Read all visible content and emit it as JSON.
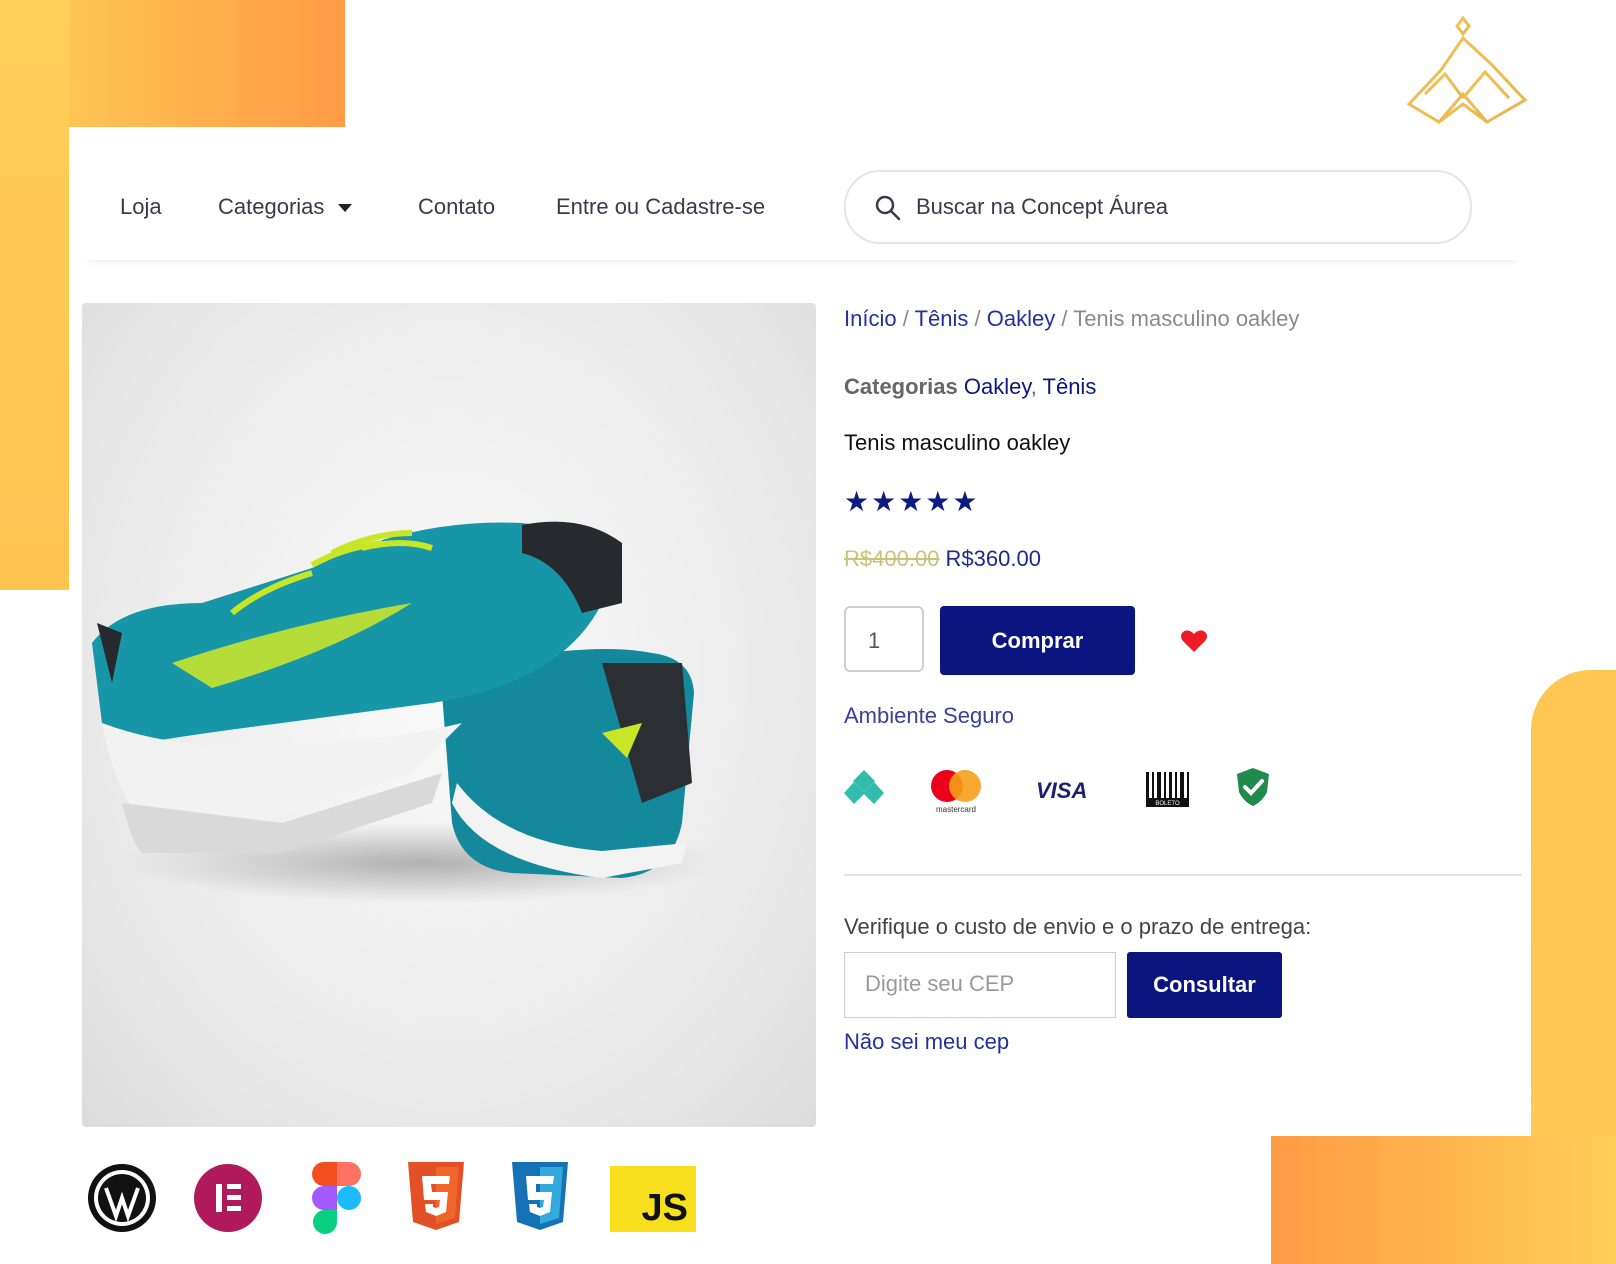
{
  "nav": {
    "items": [
      "Loja",
      "Categorias",
      "Contato",
      "Entre ou Cadastre-se"
    ],
    "search_placeholder": "Buscar na Concept Áurea"
  },
  "breadcrumb": {
    "items": [
      "Início",
      "Tênis",
      "Oakley"
    ],
    "current": "Tenis masculino oakley",
    "separator": "/"
  },
  "product": {
    "categories_label": "Categorias",
    "categories": [
      "Oakley",
      "Tênis"
    ],
    "title": "Tenis masculino oakley",
    "rating_stars": 5,
    "stars_text": "★★★★★",
    "old_price": "R$400.00",
    "price": "R$360.00",
    "quantity": "1",
    "buy_label": "Comprar"
  },
  "security": {
    "label": "Ambiente Seguro",
    "visa_text": "VISA",
    "mastercard_text": "mastercard",
    "boleto_text": "BOLETO"
  },
  "shipping": {
    "label": "Verifique o custo de envio e o prazo de entrega:",
    "cep_placeholder": "Digite seu CEP",
    "button_label": "Consultar",
    "unknown_cep_label": "Não sei meu cep"
  },
  "tech_stack": {
    "js_text": "JS"
  },
  "colors": {
    "accent": "#0b1580",
    "brand_orange": "#ff9a45",
    "brand_yellow": "#ffcf57",
    "gold": "#e9b84a"
  }
}
